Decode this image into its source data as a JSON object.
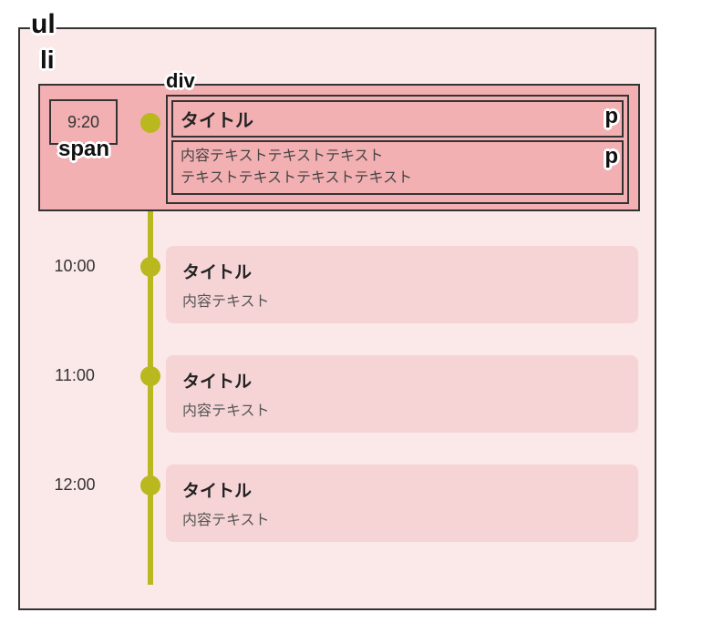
{
  "annotations": {
    "ul": "ul",
    "li": "li",
    "span": "span",
    "div": "div",
    "p": "p"
  },
  "timeline": [
    {
      "time": "9:20",
      "title": "タイトル",
      "body": "内容テキストテキストテキスト\nテキストテキストテキストテキスト",
      "highlighted": true
    },
    {
      "time": "10:00",
      "title": "タイトル",
      "body": "内容テキスト",
      "highlighted": false
    },
    {
      "time": "11:00",
      "title": "タイトル",
      "body": "内容テキスト",
      "highlighted": false
    },
    {
      "time": "12:00",
      "title": "タイトル",
      "body": "内容テキスト",
      "highlighted": false
    }
  ],
  "colors": {
    "bg": "#fbe8e9",
    "highlightBg": "#f3b0b3",
    "cardBg": "#f6d4d6",
    "accent": "#b9b81e",
    "border": "#333333"
  }
}
